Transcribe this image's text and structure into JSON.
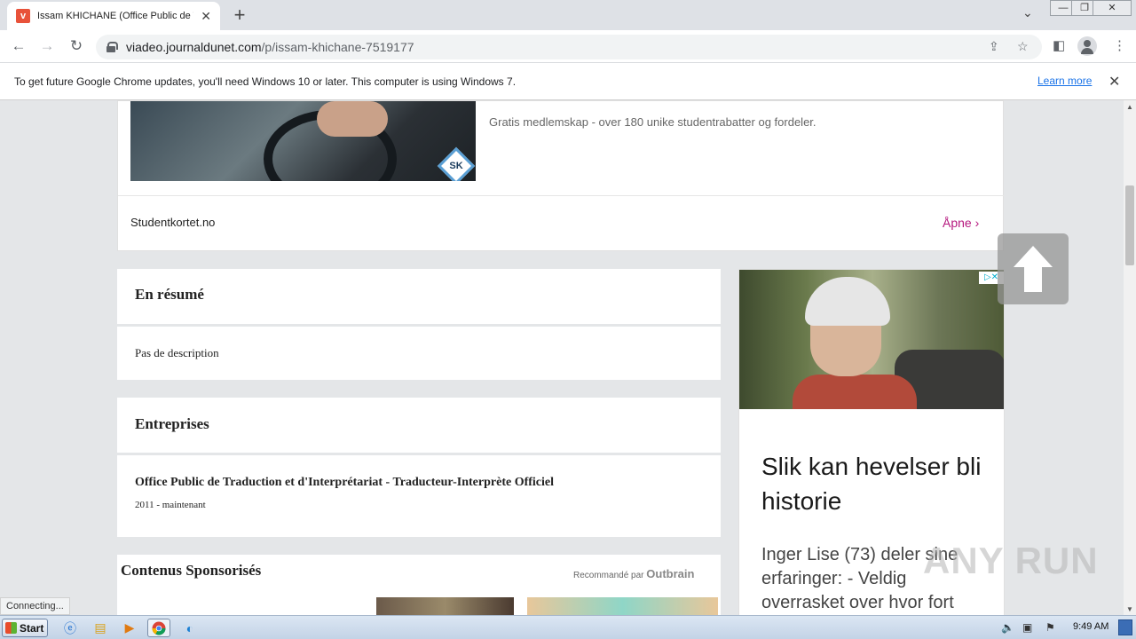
{
  "browser": {
    "tab_title": "Issam KHICHANE (Office Public de Tr",
    "url_domain": "viadeo.journaldunet.com",
    "url_path": "/p/issam-khichane-7519177",
    "status_text": "Connecting..."
  },
  "infobar": {
    "message": "To get future Google Chrome updates, you'll need Windows 10 or later. This computer is using Windows 7.",
    "learn_more": "Learn more"
  },
  "ad_top": {
    "description": "Gratis medlemskap - over 180 unike studentrabatter og fordeler.",
    "logo_text": "SK",
    "brand": "Studentkortet.no",
    "cta": "Åpne"
  },
  "resume": {
    "heading": "En résumé",
    "text": "Pas de description"
  },
  "entreprises": {
    "heading": "Entreprises",
    "company": "Office Public de Traduction et d'Interprétariat - Traducteur-Interprète Officiel",
    "period": "2011 - maintenant"
  },
  "sponsored": {
    "heading": "Contenus Sponsorisés",
    "recommended_by": "Recommandé par",
    "provider": "Outbrain"
  },
  "side_ad": {
    "headline": "Slik kan hevelser bli historie",
    "body": "Inger Lise (73) deler sine erfaringer: - Veldig overrasket over hvor fort"
  },
  "watermark": "ANY RUN",
  "taskbar": {
    "start_label": "Start",
    "time": "9:49 AM"
  }
}
